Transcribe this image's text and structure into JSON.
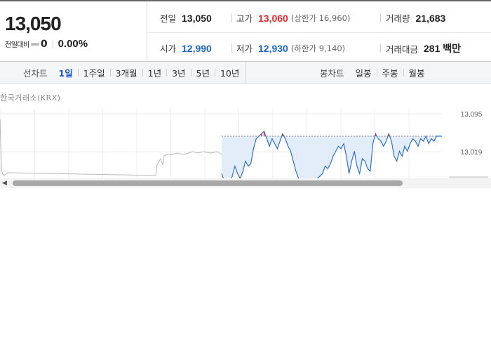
{
  "quote": {
    "current_price": "13,050",
    "change_label": "전일대비",
    "change_amount": "0",
    "change_percent": "0.00%"
  },
  "info": {
    "prev_close_label": "전일",
    "prev_close": "13,050",
    "high_label": "고가",
    "high": "13,060",
    "upper_limit": "(상한가 16,960)",
    "volume_label": "거래량",
    "volume": "21,683",
    "open_label": "시가",
    "open": "12,990",
    "low_label": "저가",
    "low": "12,930",
    "lower_limit": "(하한가 9,140)",
    "amount_label": "거래대금",
    "amount": "281 백만"
  },
  "line_tabs": {
    "label": "선차트",
    "items": [
      "1일",
      "1주일",
      "3개월",
      "1년",
      "3년",
      "5년",
      "10년"
    ],
    "active": 0
  },
  "candle_tabs": {
    "label": "봉차트",
    "items": [
      "일봉",
      "주봉",
      "월봉"
    ]
  },
  "chart_source": "한국거래소(KRX)",
  "colors": {
    "up": "#e22a2a",
    "down": "#1a66cc",
    "line": "#2d6fd6",
    "fill": "#e3edf9",
    "pre_market": "#b8b8b8"
  },
  "chart_data": {
    "type": "line",
    "y_tick_labels": [
      "13,095",
      "13,019"
    ],
    "y_ticks": [
      13095,
      13019
    ],
    "prev_close_line": 13050,
    "ylim": [
      12929,
      13112
    ],
    "grid": true,
    "series": [
      {
        "values": [
          12975,
          12960,
          12950,
          12955,
          12970,
          12990,
          12975,
          12965,
          12980,
          13000,
          12990,
          12995,
          13025,
          13045,
          13050,
          13055,
          13060,
          13045,
          13030,
          13045,
          13035,
          13025,
          13040,
          13055,
          13045,
          13030,
          13020,
          13000,
          12980,
          12965,
          12950,
          12940,
          12945,
          12940,
          12950,
          12960,
          12965,
          12970,
          12975,
          12990,
          12985,
          12995,
          13010,
          13020,
          13030,
          13025,
          13035,
          13010,
          12975,
          13000,
          13020,
          12990,
          12975,
          13005,
          13000,
          12985,
          12980,
          13035,
          13055,
          13045,
          13040,
          13030,
          13040,
          13055,
          13040,
          13010,
          13000,
          13020,
          13010,
          13030,
          13020,
          13035,
          13045,
          13040,
          13030,
          13045,
          13040,
          13050,
          13035,
          13045,
          13040,
          13050,
          13050,
          13050
        ]
      }
    ]
  }
}
